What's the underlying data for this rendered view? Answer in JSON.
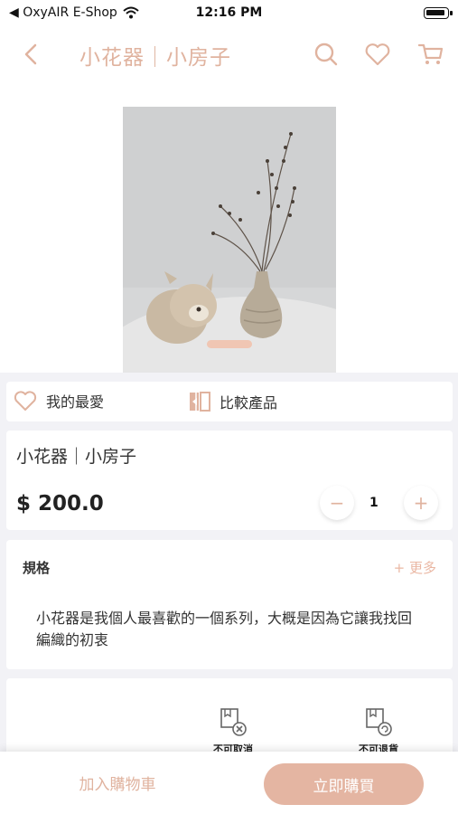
{
  "status_bar": {
    "carrier": "◀ OxyAIR E-Shop",
    "time": "12:16 PM"
  },
  "header": {
    "title": "小花器｜小房子",
    "icons": [
      "back-icon",
      "search-icon",
      "heart-icon",
      "cart-icon"
    ]
  },
  "product_image": {
    "carousel_active_index": 0
  },
  "actions": {
    "favorite_label": "我的最愛",
    "compare_label": "比較產品"
  },
  "product": {
    "name": "小花器｜小房子",
    "price": "$ 200.0",
    "quantity": "1"
  },
  "spec": {
    "title": "規格",
    "more": "+ 更多",
    "description": "小花器是我個人最喜歡的一個系列，大概是因為它讓我找回編織的初衷"
  },
  "policies": [
    {
      "label": "不可取消",
      "icon": "no-cancel-icon"
    },
    {
      "label": "不可退貨",
      "icon": "no-return-icon"
    }
  ],
  "footer": {
    "add_to_cart": "加入購物車",
    "buy_now": "立即購買"
  },
  "colors": {
    "accent": "#e0b39f",
    "button_bg": "#e4b5a2",
    "page_bg": "#f2f2f6"
  }
}
